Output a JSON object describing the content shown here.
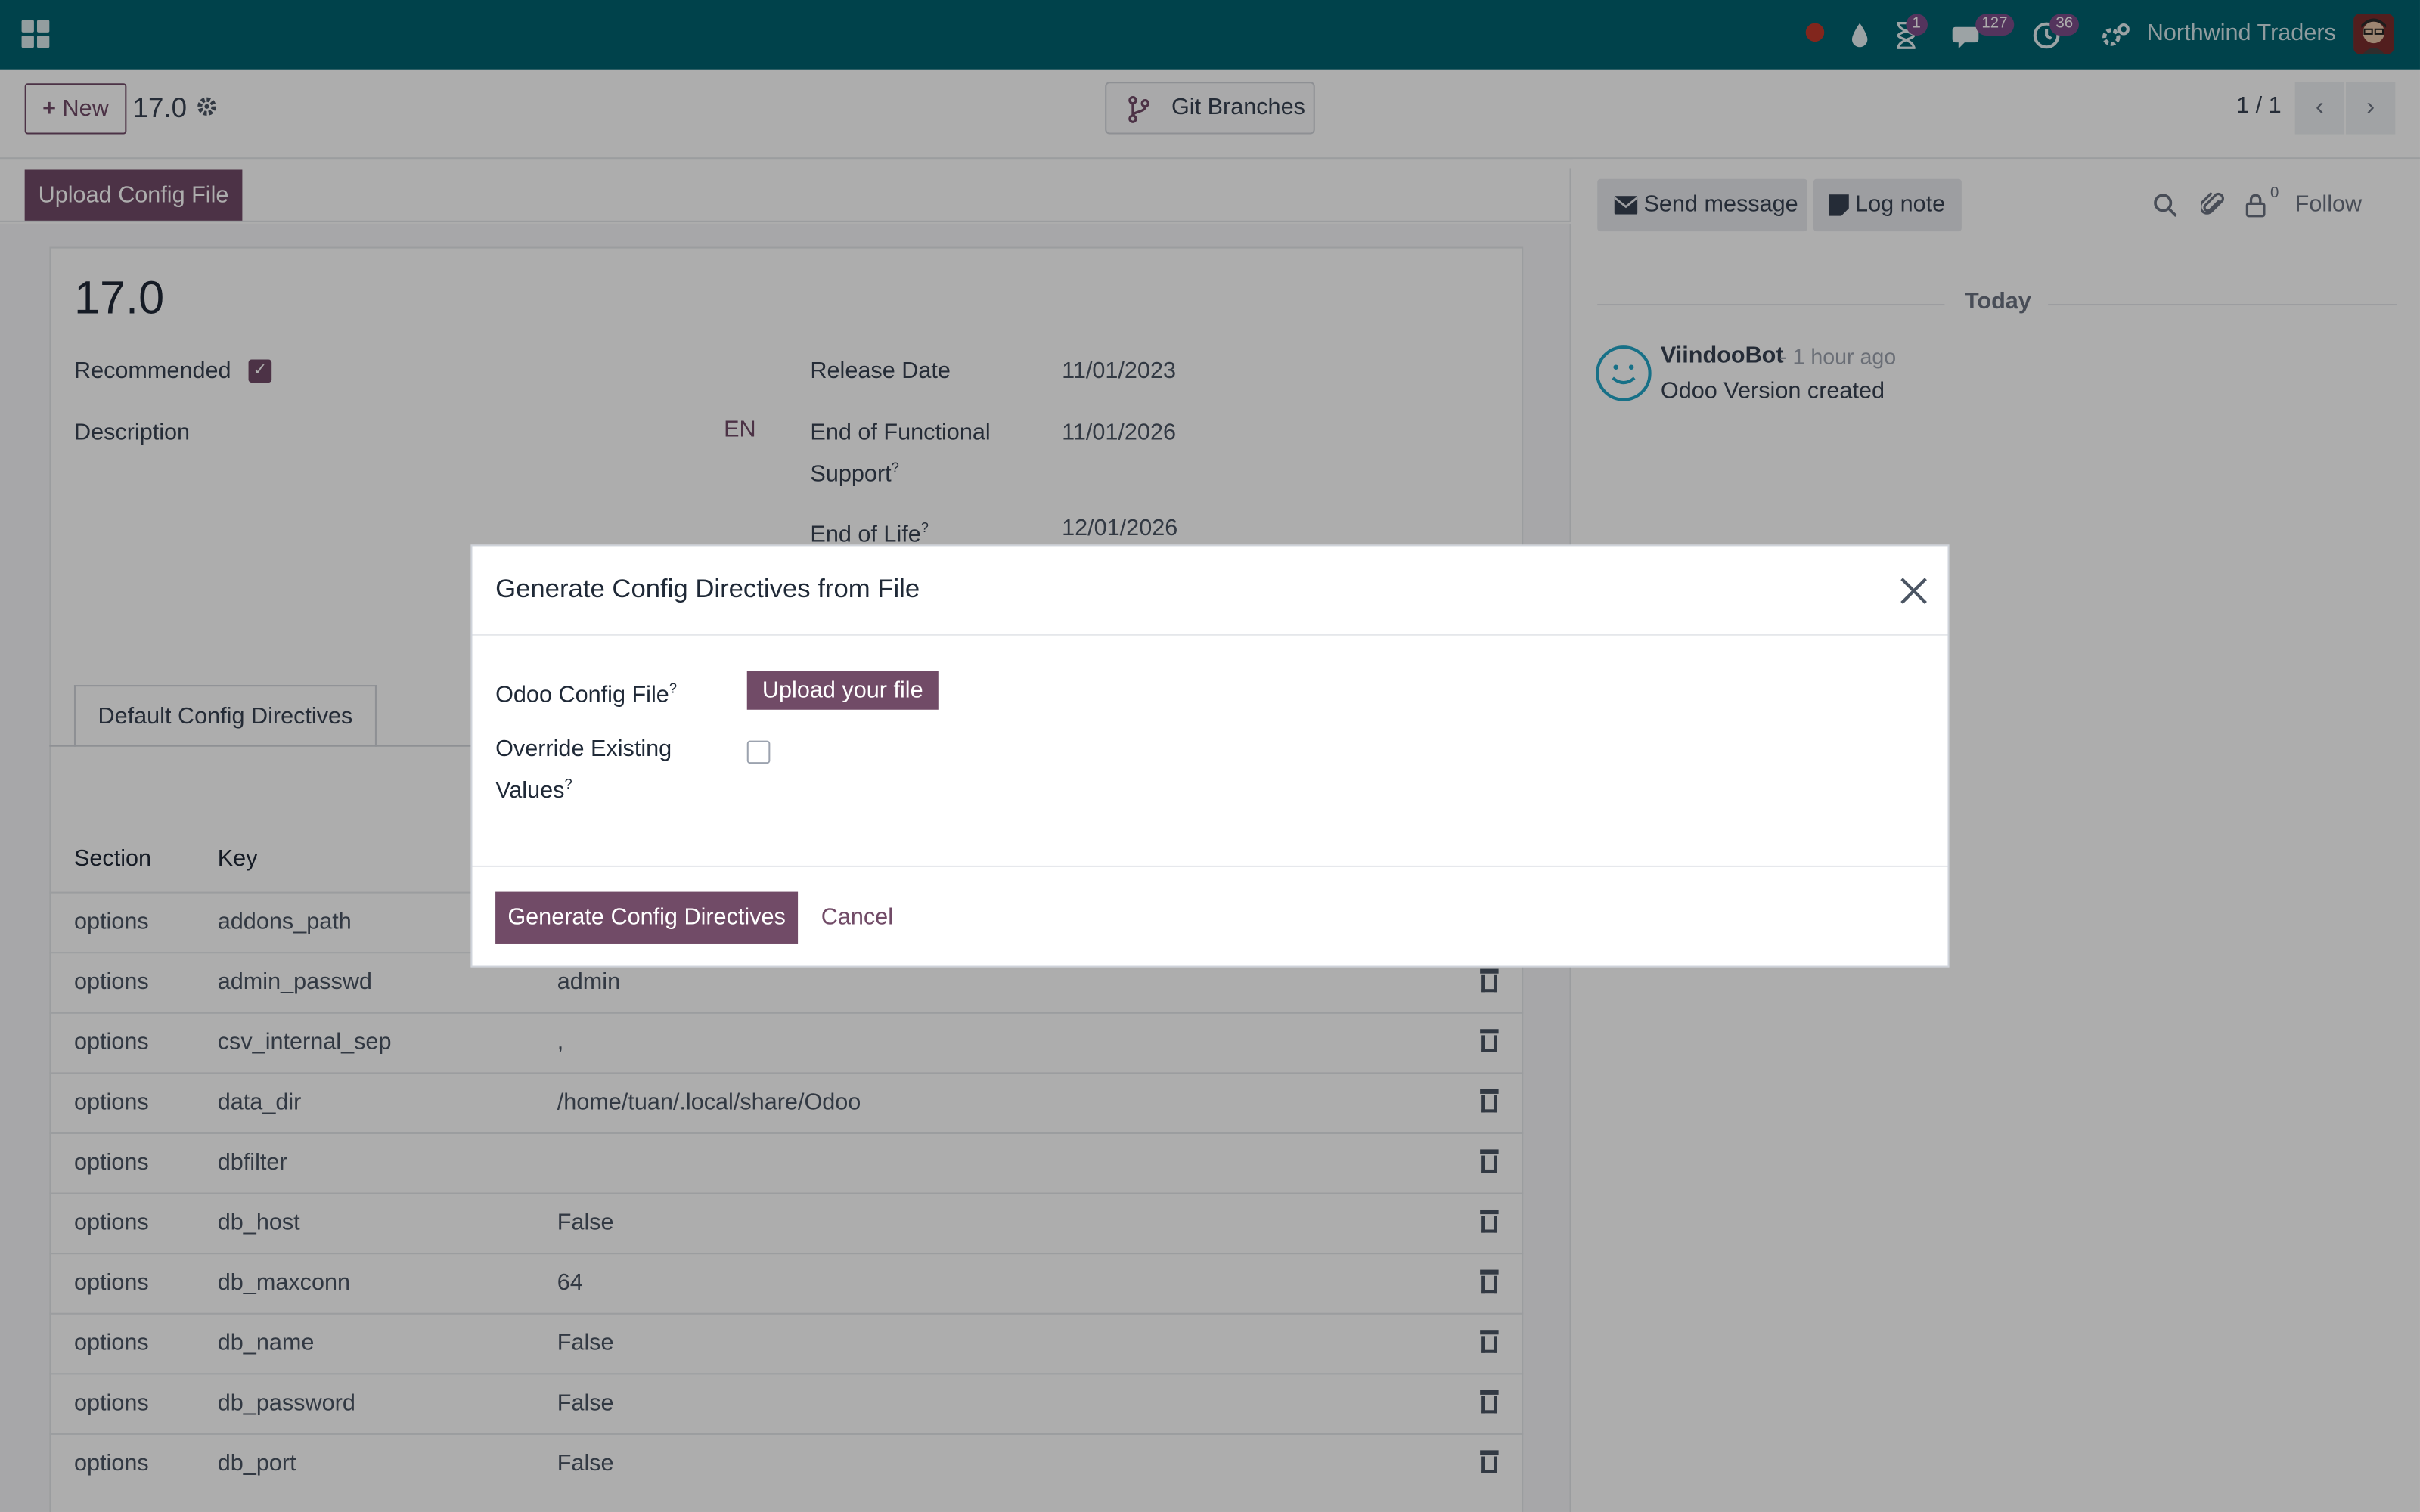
{
  "navbar": {
    "company": "Northwind Traders",
    "badges": {
      "activities": "1",
      "messages": "127",
      "clock": "36"
    }
  },
  "control": {
    "new_label": "New",
    "record_title": "17.0",
    "git_label": "Git Branches",
    "pager": "1 / 1"
  },
  "form": {
    "upload_config_label": "Upload Config File",
    "title": "17.0",
    "recommended_label": "Recommended",
    "description_label": "Description",
    "lang_label": "EN",
    "release_date_label": "Release Date",
    "release_date": "11/01/2023",
    "eofs_label_1": "End of Functional",
    "eofs_label_2": "Support",
    "eofs_value": "11/01/2026",
    "eol_label": "End of Life",
    "eol_value": "12/01/2026",
    "tab_label": "Default Config Directives",
    "columns": [
      "Section",
      "Key"
    ],
    "rows": [
      {
        "section": "options",
        "key": "addons_path",
        "value": ""
      },
      {
        "section": "options",
        "key": "admin_passwd",
        "value": "admin"
      },
      {
        "section": "options",
        "key": "csv_internal_sep",
        "value": ","
      },
      {
        "section": "options",
        "key": "data_dir",
        "value": "/home/tuan/.local/share/Odoo"
      },
      {
        "section": "options",
        "key": "dbfilter",
        "value": ""
      },
      {
        "section": "options",
        "key": "db_host",
        "value": "False"
      },
      {
        "section": "options",
        "key": "db_maxconn",
        "value": "64"
      },
      {
        "section": "options",
        "key": "db_name",
        "value": "False"
      },
      {
        "section": "options",
        "key": "db_password",
        "value": "False"
      },
      {
        "section": "options",
        "key": "db_port",
        "value": "False"
      }
    ]
  },
  "chatter": {
    "send_message": "Send message",
    "log_note": "Log note",
    "followers_count": "0",
    "follow": "Follow",
    "today": "Today",
    "author": "ViindooBot",
    "time": "- 1 hour ago",
    "message": "Odoo Version created"
  },
  "modal": {
    "title": "Generate Config Directives from File",
    "file_label": "Odoo Config File",
    "upload_button": "Upload your file",
    "override_label_1": "Override Existing",
    "override_label_2": "Values",
    "help_mark": "?",
    "generate_button": "Generate Config Directives",
    "cancel_button": "Cancel"
  },
  "colors": {
    "navbar": "#00626f",
    "primary": "#714b67"
  }
}
